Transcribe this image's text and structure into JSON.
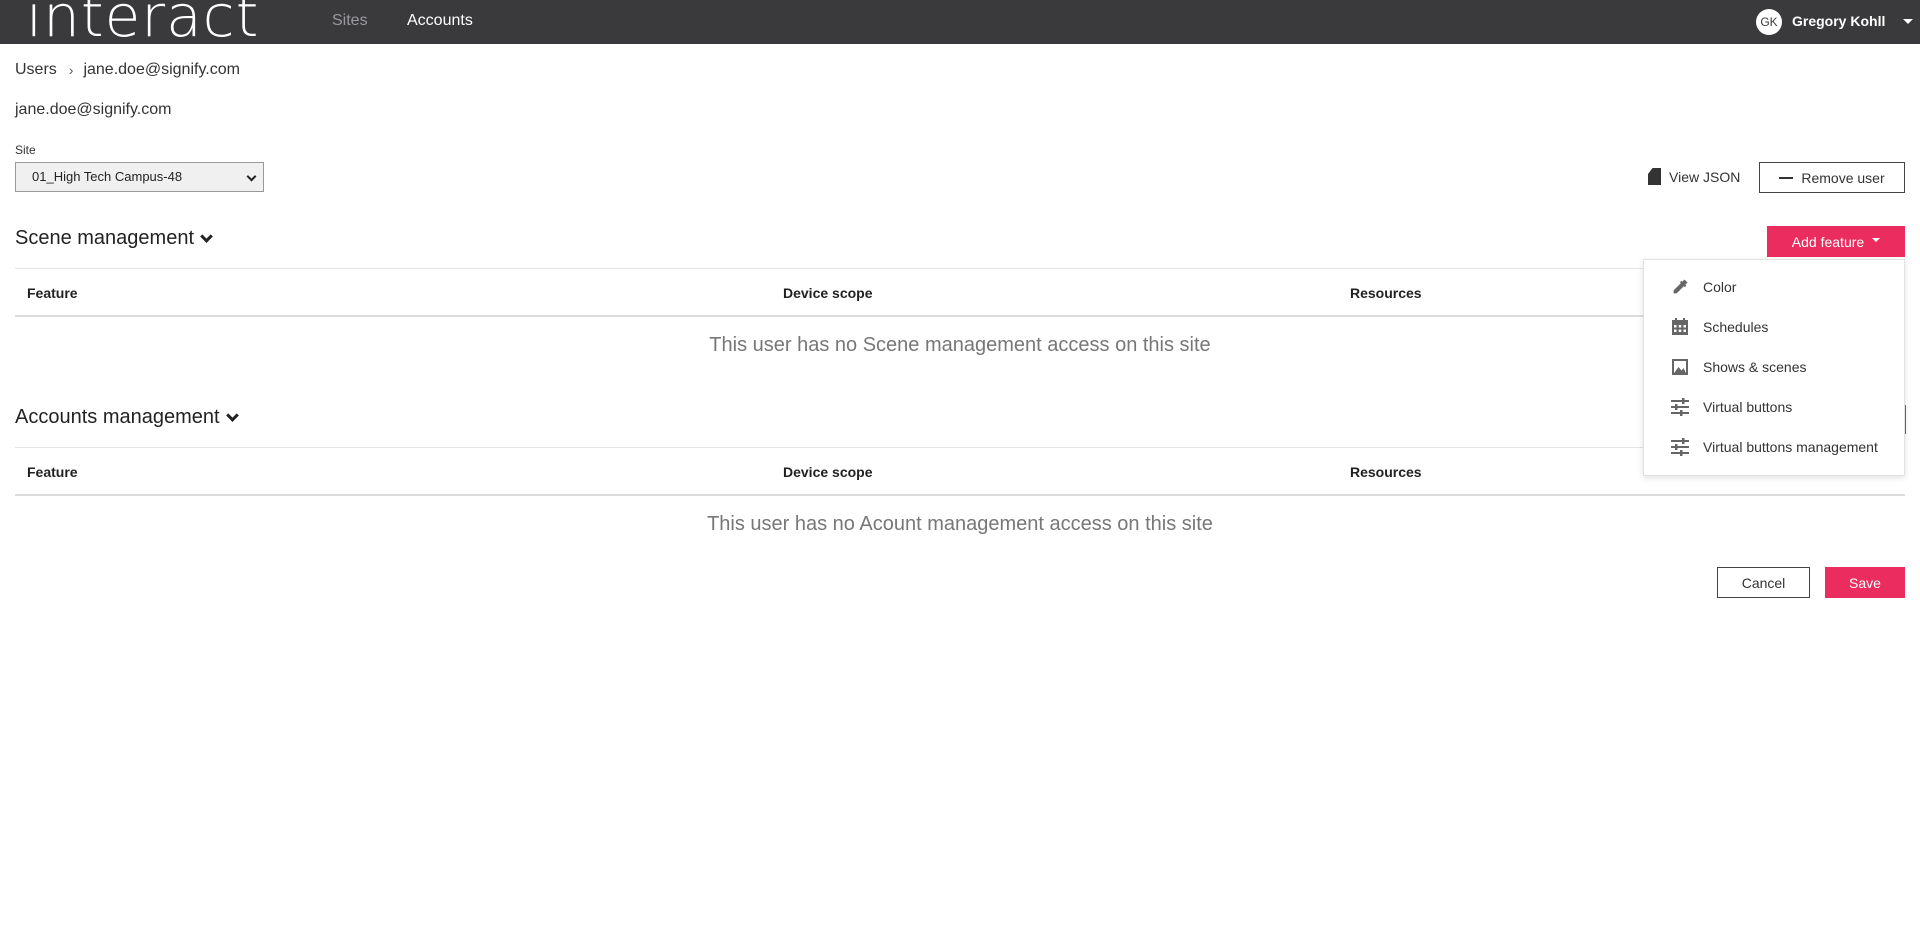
{
  "topbar": {
    "logo": "interact",
    "nav": {
      "sites": "Sites",
      "accounts": "Accounts"
    },
    "user": {
      "initials": "GK",
      "name": "Gregory Kohll"
    }
  },
  "breadcrumb": {
    "root": "Users",
    "current": "jane.doe@signify.com"
  },
  "user_heading": "jane.doe@signify.com",
  "site": {
    "label": "Site",
    "selected": "01_High Tech Campus-48"
  },
  "actions": {
    "view_json": "View JSON",
    "remove_user": "Remove user"
  },
  "scene_section": {
    "title": "Scene management",
    "add_feature": "Add feature",
    "columns": [
      "Feature",
      "Device scope",
      "Resources"
    ],
    "empty": "This user has no Scene management access on this site"
  },
  "accounts_section": {
    "title": "Accounts management",
    "columns": [
      "Feature",
      "Device scope",
      "Resources"
    ],
    "empty": "This user has no Acount management access on this site"
  },
  "dropdown": {
    "items": [
      {
        "label": "Color",
        "icon": "eyedropper-icon"
      },
      {
        "label": "Schedules",
        "icon": "calendar-icon"
      },
      {
        "label": "Shows & scenes",
        "icon": "image-icon"
      },
      {
        "label": "Virtual buttons",
        "icon": "sliders-icon"
      },
      {
        "label": "Virtual buttons management",
        "icon": "sliders-icon"
      }
    ]
  },
  "footer": {
    "cancel": "Cancel",
    "save": "Save"
  },
  "colors": {
    "topbar": "#3a3a3d",
    "accent": "#ea2c5e"
  }
}
